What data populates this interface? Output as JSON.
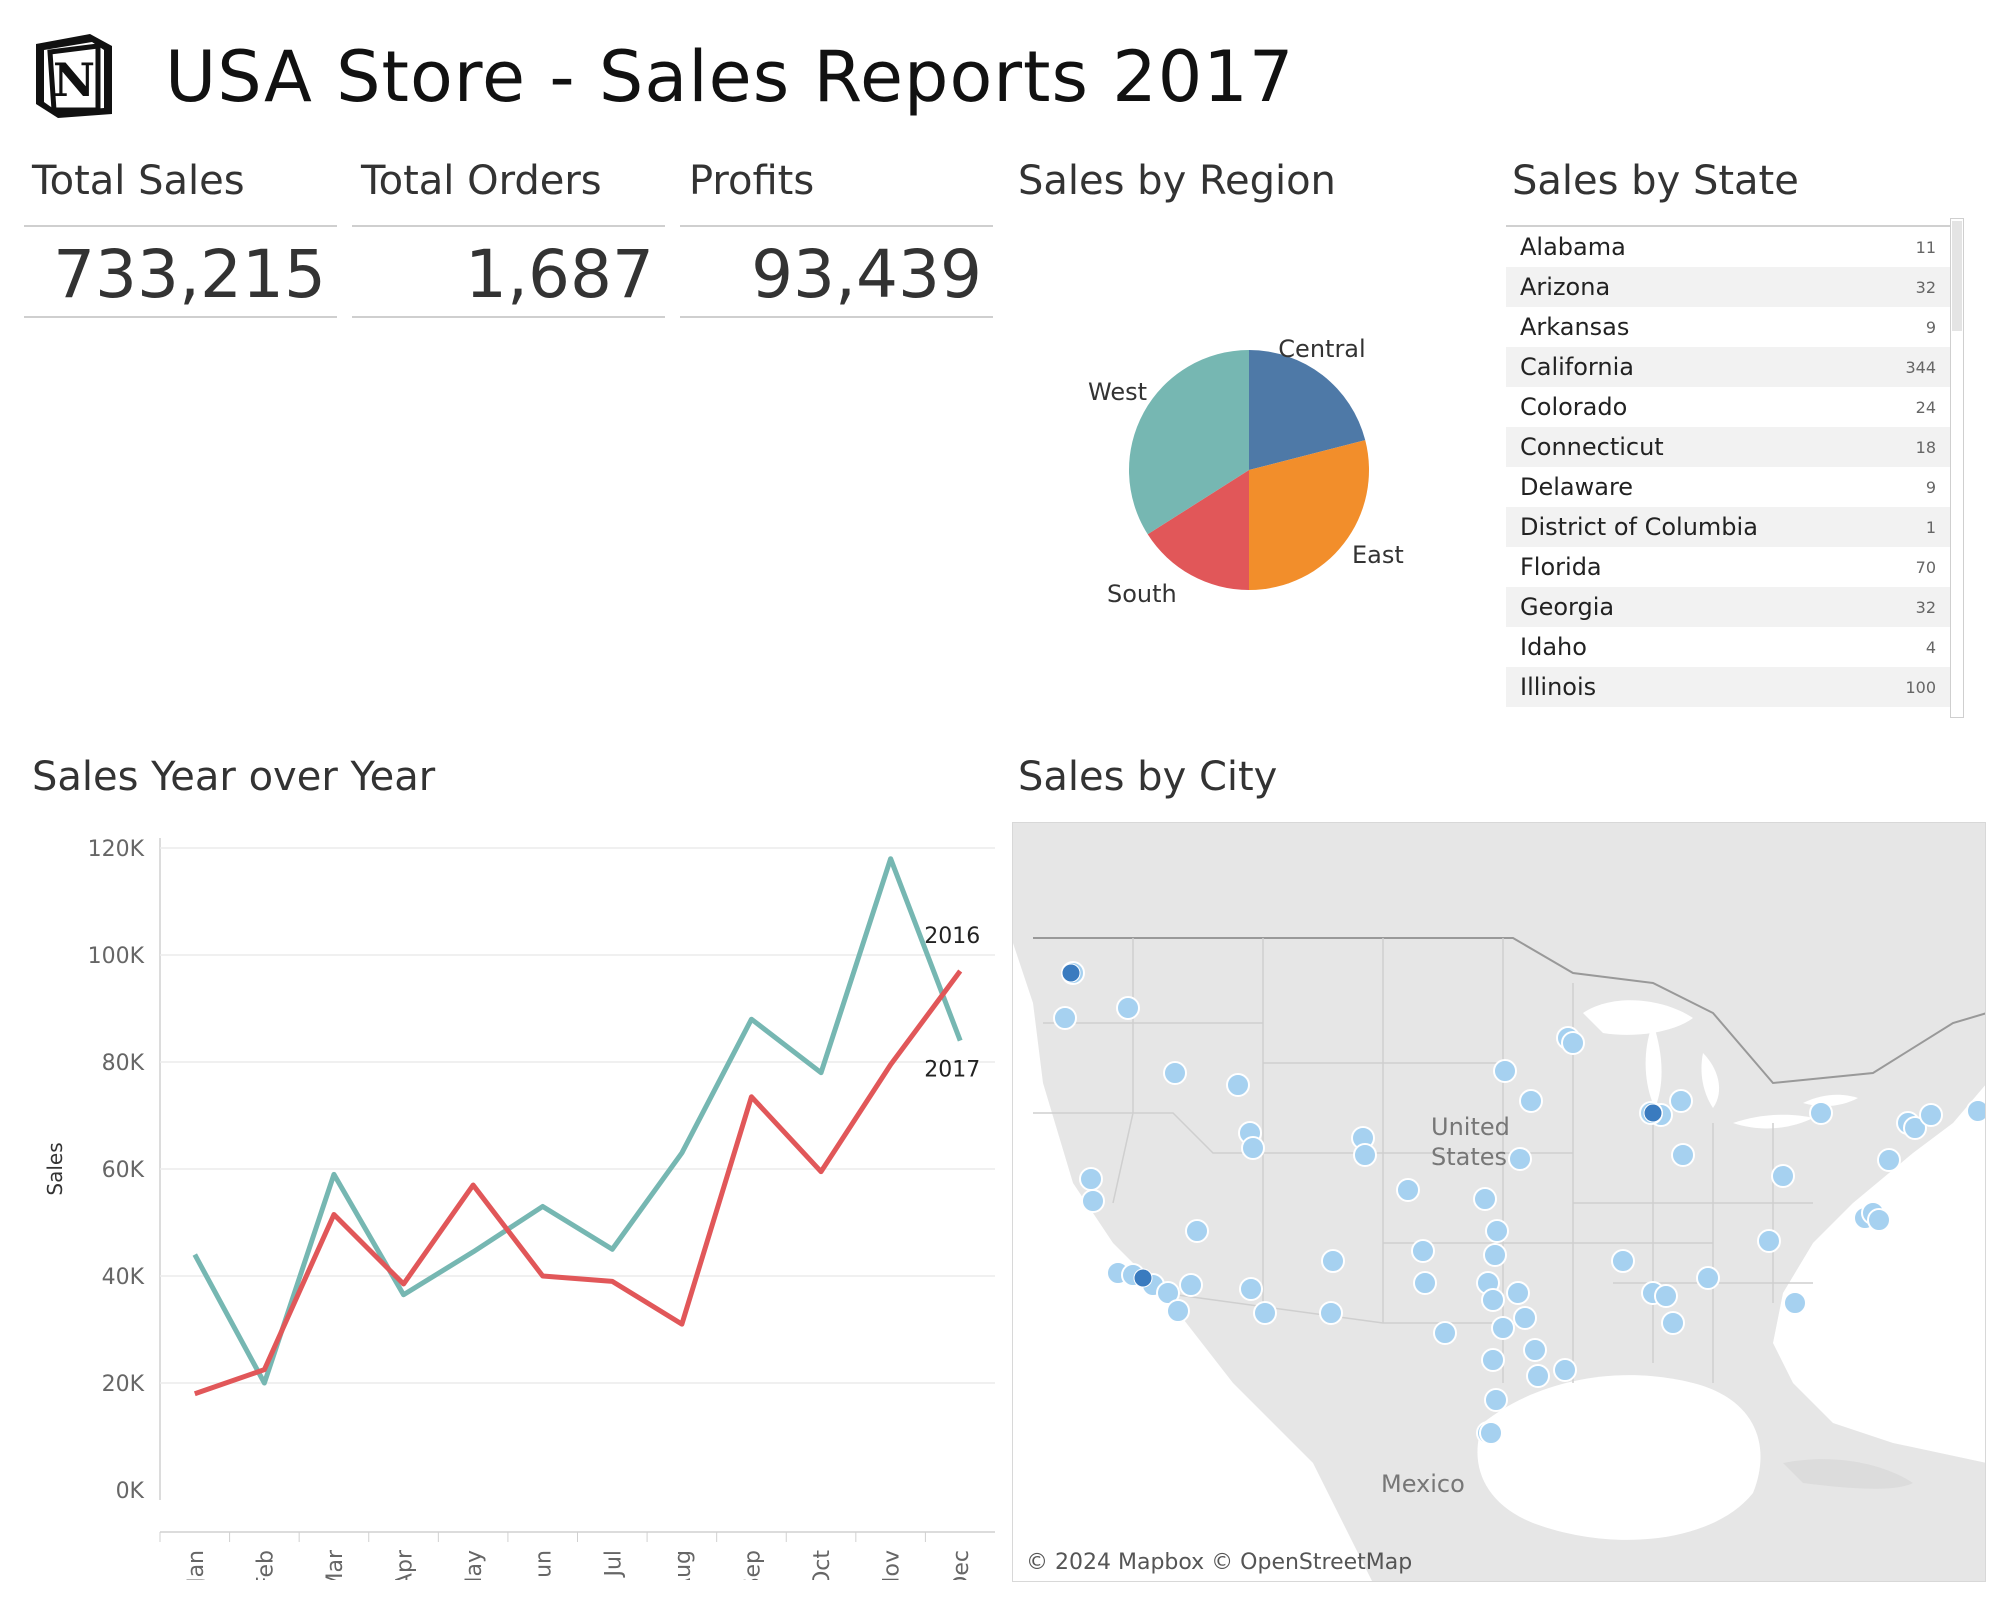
{
  "header": {
    "title": "USA Store - Sales Reports 2017",
    "logo_letter": "N",
    "logo_icon": "notion-logo-icon"
  },
  "kpis": [
    {
      "label": "Total Sales",
      "value": "733,215"
    },
    {
      "label": "Total Orders",
      "value": "1,687"
    },
    {
      "label": "Profits",
      "value": "93,439"
    }
  ],
  "colors": {
    "central": "#4e79a7",
    "east": "#f28e2b",
    "south": "#e15759",
    "west": "#76b7b2",
    "series_2016": "#76b7b2",
    "series_2017": "#e15759",
    "map_bubble": "#a6d1f0",
    "map_bubble_dark": "#3a7bbf"
  },
  "region_chart": {
    "title": "Sales by Region",
    "chart_data": {
      "type": "pie",
      "title": "",
      "slices": [
        {
          "label": "Central",
          "value": 21
        },
        {
          "label": "East",
          "value": 29
        },
        {
          "label": "South",
          "value": 16
        },
        {
          "label": "West",
          "value": 34
        }
      ]
    }
  },
  "state_table": {
    "title": "Sales by State",
    "rows": [
      {
        "state": "Alabama",
        "count": "11"
      },
      {
        "state": "Arizona",
        "count": "32"
      },
      {
        "state": "Arkansas",
        "count": "9"
      },
      {
        "state": "California",
        "count": "344"
      },
      {
        "state": "Colorado",
        "count": "24"
      },
      {
        "state": "Connecticut",
        "count": "18"
      },
      {
        "state": "Delaware",
        "count": "9"
      },
      {
        "state": "District of Columbia",
        "count": "1"
      },
      {
        "state": "Florida",
        "count": "70"
      },
      {
        "state": "Georgia",
        "count": "32"
      },
      {
        "state": "Idaho",
        "count": "4"
      },
      {
        "state": "Illinois",
        "count": "100"
      }
    ]
  },
  "yoy_chart": {
    "title": "Sales Year over Year",
    "chart_data": {
      "type": "line",
      "title": "",
      "xlabel": "",
      "ylabel": "Sales",
      "categories": [
        "Jan",
        "Feb",
        "Mar",
        "Apr",
        "May",
        "Jun",
        "Jul",
        "Aug",
        "Sep",
        "Oct",
        "Nov",
        "Dec"
      ],
      "ylim": [
        0,
        120000
      ],
      "yticks": [
        0,
        20000,
        40000,
        60000,
        80000,
        100000,
        120000
      ],
      "ytick_labels": [
        "0K",
        "20K",
        "40K",
        "60K",
        "80K",
        "100K",
        "120K"
      ],
      "grid": true,
      "series": [
        {
          "name": "2016",
          "values": [
            44000,
            20000,
            59000,
            36500,
            44500,
            53000,
            45000,
            63000,
            88000,
            78000,
            118000,
            84000
          ]
        },
        {
          "name": "2017",
          "values": [
            18000,
            22500,
            51500,
            38500,
            57000,
            40000,
            39000,
            31000,
            73500,
            59500,
            79500,
            97000
          ]
        }
      ]
    }
  },
  "city_map": {
    "title": "Sales by City",
    "labels": {
      "country": "United\nStates",
      "country_line1": "United",
      "country_line2": "States",
      "mexico": "Mexico"
    },
    "credit": "© 2024 Mapbox © OpenStreetMap"
  }
}
